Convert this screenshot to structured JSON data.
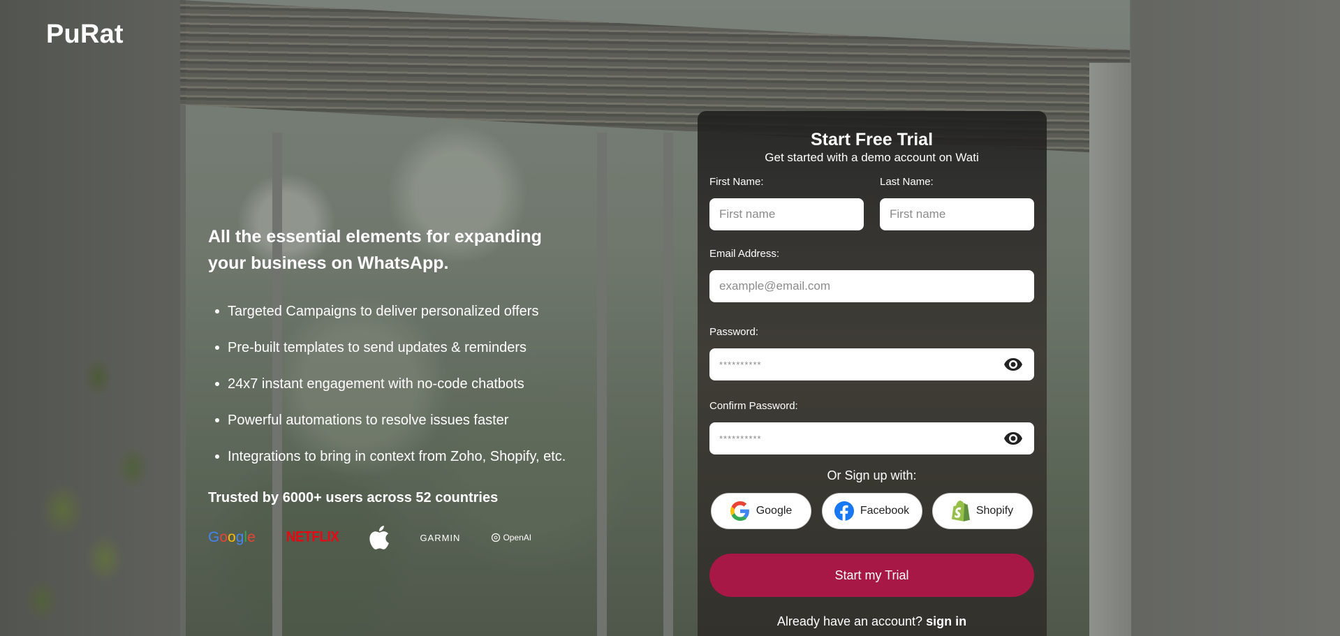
{
  "brand": {
    "name": "PuRat"
  },
  "pitch": {
    "heading_line1": "All the essential elements for expanding",
    "heading_line2": "your business on WhatsApp.",
    "features": [
      "Targeted Campaigns to deliver personalized offers",
      "Pre-built templates to send updates & reminders",
      "24x7 instant engagement with no-code chatbots",
      "Powerful automations to resolve issues faster",
      "Integrations to bring in context from Zoho, Shopify, etc."
    ],
    "trusted": "Trusted by 6000+ users across 52 countries",
    "logos": {
      "google": [
        "G",
        "o",
        "o",
        "g",
        "l",
        "e"
      ],
      "netflix": "NETFLIX",
      "apple": "apple-icon",
      "garmin": "GARMIN",
      "openai": "OpenAI"
    }
  },
  "form": {
    "title": "Start Free Trial",
    "subtitle": "Get started with a demo account on Wati",
    "first_name": {
      "label": "First Name:",
      "placeholder": "First name",
      "value": ""
    },
    "last_name": {
      "label": "Last Name:",
      "placeholder": "First name",
      "value": ""
    },
    "email": {
      "label": "Email Address:",
      "placeholder": "example@email.com",
      "value": ""
    },
    "password": {
      "label": "Password:",
      "placeholder": "**********",
      "value": ""
    },
    "confirm_password": {
      "label": "Confirm Password:",
      "placeholder": "**********",
      "value": ""
    },
    "or_label": "Or Sign up with:",
    "socials": {
      "google": "Google",
      "facebook": "Facebook",
      "shopify": "Shopify"
    },
    "submit": "Start my Trial",
    "signin_prompt": "Already have an account?",
    "signin_link": "sign in"
  },
  "colors": {
    "cta": "#a71846",
    "netflix": "#e50914",
    "facebook": "#1877f2",
    "shopify": "#95bf47"
  }
}
